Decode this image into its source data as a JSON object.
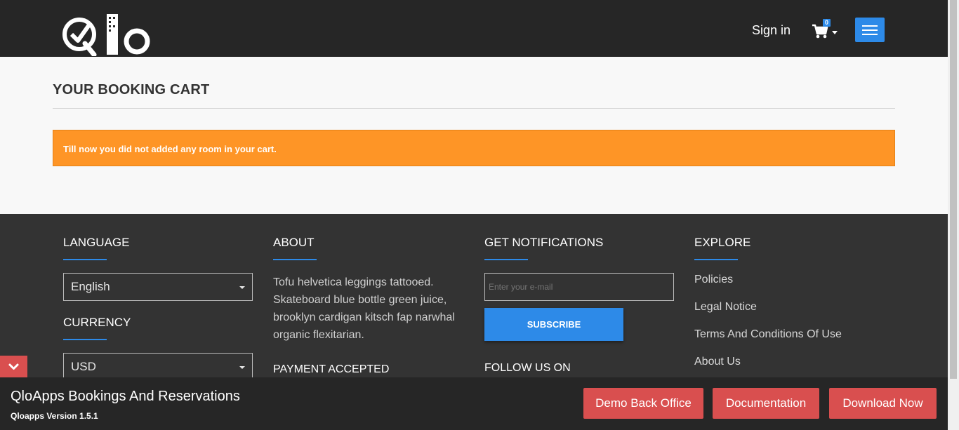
{
  "header": {
    "logo_alt": "Qlo",
    "signin_label": "Sign in",
    "cart_count": "0"
  },
  "main": {
    "page_title": "YOUR BOOKING CART",
    "alert_message": "Till now you did not added any room in your cart."
  },
  "footer": {
    "language": {
      "heading": "LANGUAGE",
      "selected": "English"
    },
    "currency": {
      "heading": "CURRENCY",
      "selected": "USD"
    },
    "about": {
      "heading": "ABOUT",
      "text": "Tofu helvetica leggings tattooed. Skateboard blue bottle green juice, brooklyn cardigan kitsch fap narwhal organic flexitarian."
    },
    "payment": {
      "heading": "PAYMENT ACCEPTED"
    },
    "notifications": {
      "heading": "GET NOTIFICATIONS",
      "email_placeholder": "Enter your e-mail",
      "subscribe_label": "SUBSCRIBE"
    },
    "follow": {
      "heading": "FOLLOW US ON"
    },
    "explore": {
      "heading": "EXPLORE",
      "links": [
        "Policies",
        "Legal Notice",
        "Terms And Conditions Of Use",
        "About Us"
      ]
    }
  },
  "bottom_bar": {
    "title": "QloApps Bookings And Reservations",
    "version": "Qloapps Version 1.5.1",
    "buttons": [
      "Demo Back Office",
      "Documentation",
      "Download Now"
    ]
  },
  "colors": {
    "header_bg": "#262626",
    "accent_blue": "#2d8ae8",
    "alert_orange": "#fe9526",
    "footer_bg": "#333333",
    "button_red": "#d94f4f"
  },
  "icons": [
    "cart-icon",
    "caret-down-icon",
    "hamburger-menu-icon",
    "chevron-down-icon"
  ]
}
